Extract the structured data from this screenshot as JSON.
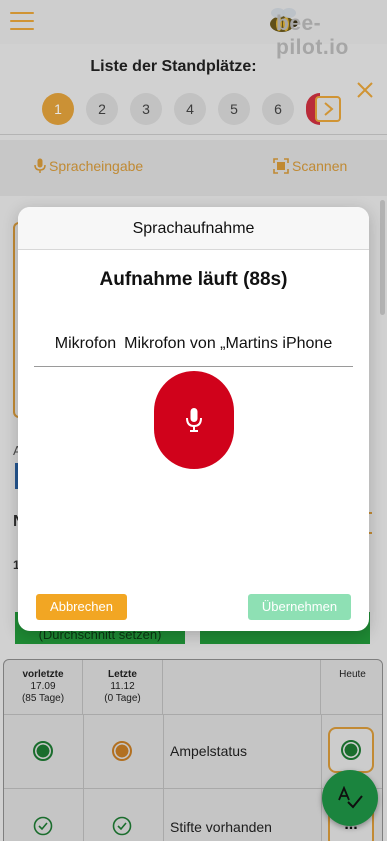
{
  "app": {
    "logo_text": "bee-pilot.io",
    "list_title": "Liste der Standplätze:",
    "pager": [
      "1",
      "2",
      "3",
      "4",
      "5",
      "6"
    ],
    "pager_active_index": 0,
    "actions": {
      "speech_label": "Spracheingabe",
      "scan_label": "Scannen"
    }
  },
  "background": {
    "a_label": "A",
    "n_label": "N",
    "one_label": "1",
    "left_green_button": "(Durchschnitt setzen)",
    "table": {
      "columns": [
        {
          "title": "vorletzte",
          "date": "17.09",
          "days": "(85 Tage)"
        },
        {
          "title": "Letzte",
          "date": "11.12",
          "days": "(0 Tage)"
        },
        {
          "title": "",
          "date": "",
          "days": ""
        },
        {
          "title": "Heute",
          "date": "",
          "days": ""
        }
      ],
      "rows": [
        {
          "label": "Ampelstatus",
          "vorletzte": "green",
          "letzte": "orange",
          "heute": "green"
        },
        {
          "label": "Stifte vorhanden",
          "vorletzte": "check",
          "letzte": "check",
          "heute": "..."
        }
      ]
    }
  },
  "modal": {
    "title": "Sprachaufnahme",
    "status": "Aufnahme läuft (88s)",
    "mic_label": "Mikrofon",
    "mic_value": "Mikrofon von „Martins iPhone",
    "cancel_label": "Abbrechen",
    "accept_label": "Übernehmen"
  },
  "colors": {
    "accent": "#e8a53a",
    "record_red": "#d0021b",
    "cancel_orange": "#f2a623",
    "accept_green_disabled": "#8ee0b4",
    "fab_green": "#1f9446",
    "status_green": "#1e7a33",
    "status_orange": "#c77d25"
  },
  "icons": {
    "menu": "hamburger-icon",
    "close": "close-icon",
    "next": "chevron-right-icon",
    "speech": "microphone-icon",
    "scan": "scan-icon",
    "record": "microphone-icon",
    "fab": "spellcheck-icon",
    "check": "check-circle-icon"
  }
}
